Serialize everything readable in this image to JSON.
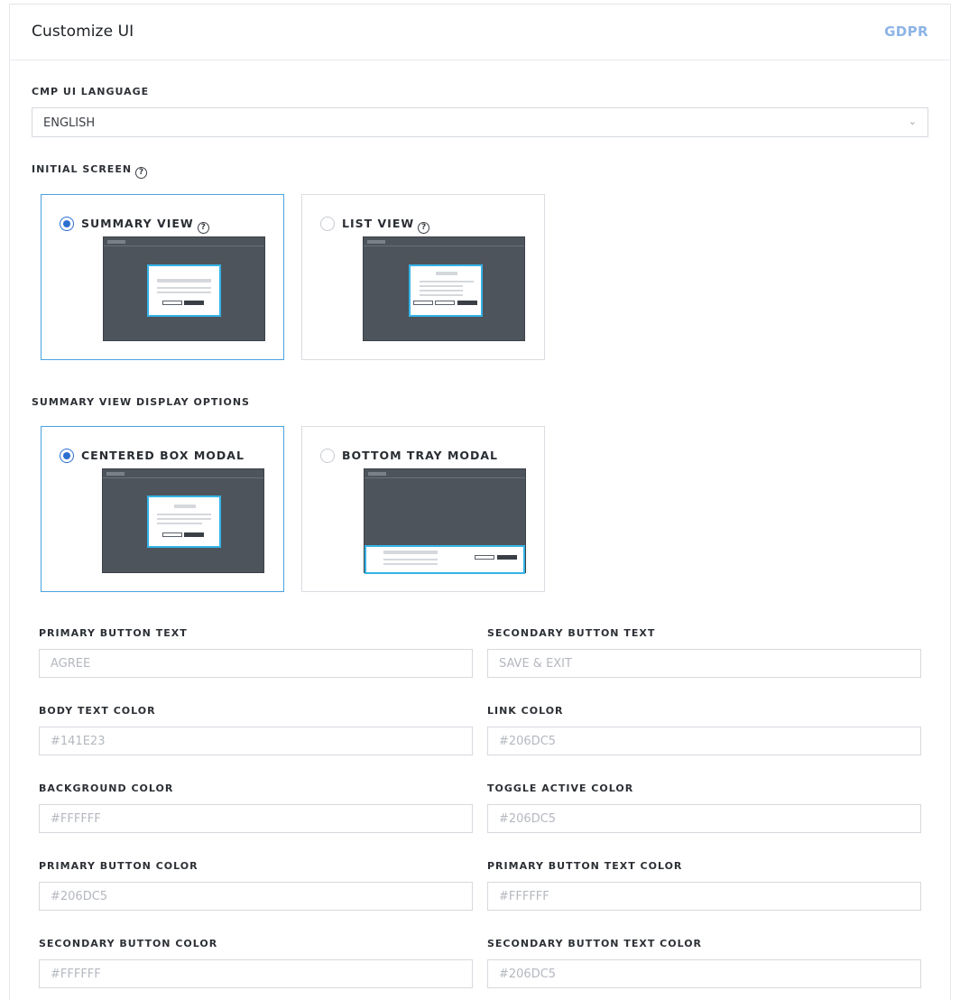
{
  "header": {
    "title": "Customize UI",
    "gdpr_link": "GDPR"
  },
  "language": {
    "label": "CMP UI LANGUAGE",
    "selected": "ENGLISH"
  },
  "initial_screen": {
    "label": "INITIAL SCREEN",
    "options": [
      {
        "label": "SUMMARY VIEW",
        "selected": true
      },
      {
        "label": "LIST VIEW",
        "selected": false
      }
    ]
  },
  "display_options": {
    "label": "SUMMARY VIEW DISPLAY OPTIONS",
    "options": [
      {
        "label": "CENTERED BOX MODAL",
        "selected": true
      },
      {
        "label": "BOTTOM TRAY MODAL",
        "selected": false
      }
    ]
  },
  "fields": {
    "primary_button_text": {
      "label": "PRIMARY BUTTON TEXT",
      "placeholder": "AGREE"
    },
    "secondary_button_text": {
      "label": "SECONDARY BUTTON TEXT",
      "placeholder": "SAVE & EXIT"
    },
    "body_text_color": {
      "label": "BODY TEXT COLOR",
      "placeholder": "#141E23"
    },
    "link_color": {
      "label": "LINK COLOR",
      "placeholder": "#206DC5"
    },
    "background_color": {
      "label": "BACKGROUND COLOR",
      "placeholder": "#FFFFFF"
    },
    "toggle_active_color": {
      "label": "TOGGLE ACTIVE COLOR",
      "placeholder": "#206DC5"
    },
    "primary_button_color": {
      "label": "PRIMARY BUTTON COLOR",
      "placeholder": "#206DC5"
    },
    "primary_button_text_color": {
      "label": "PRIMARY BUTTON TEXT COLOR",
      "placeholder": "#FFFFFF"
    },
    "secondary_button_color": {
      "label": "SECONDARY BUTTON COLOR",
      "placeholder": "#FFFFFF"
    },
    "secondary_button_text_color": {
      "label": "SECONDARY BUTTON TEXT COLOR",
      "placeholder": "#206DC5"
    }
  },
  "colors": {
    "accent": "#2D6FD0",
    "selected_border": "#4AA3E0",
    "preview_highlight": "#35B3E6",
    "gdpr_link": "#8DB4E6"
  }
}
